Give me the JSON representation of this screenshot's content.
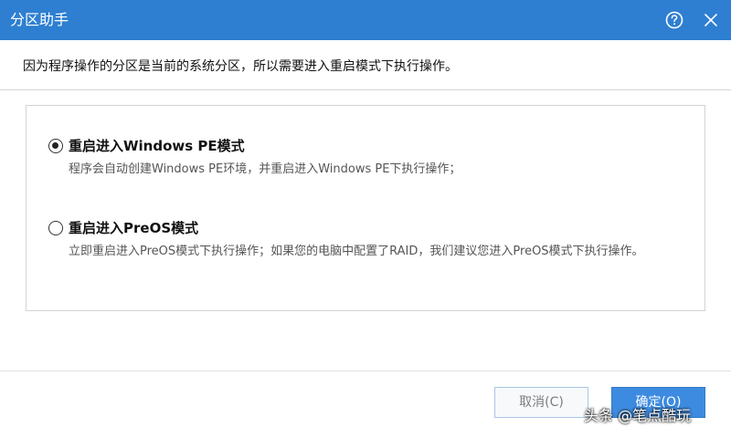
{
  "window": {
    "title": "分区助手",
    "help_icon": "help-circle-icon",
    "close_icon": "close-icon"
  },
  "message": "因为程序操作的分区是当前的系统分区，所以需要进入重启模式下执行操作。",
  "options": [
    {
      "label": "重启进入Windows PE模式",
      "description": "程序会自动创建Windows PE环境，并重启进入Windows PE下执行操作；",
      "selected": true
    },
    {
      "label": "重启进入PreOS模式",
      "description": "立即重启进入PreOS模式下执行操作；如果您的电脑中配置了RAID，我们建议您进入PreOS模式下执行操作。",
      "selected": false
    }
  ],
  "buttons": {
    "cancel_label": "取消(C)",
    "ok_label": "确定(O)"
  },
  "watermark": "头条 @笔点酷玩",
  "colors": {
    "titlebar": "#2e7fd1",
    "ok_button": "#3d8be0",
    "cancel_border": "#a9c6e6"
  }
}
